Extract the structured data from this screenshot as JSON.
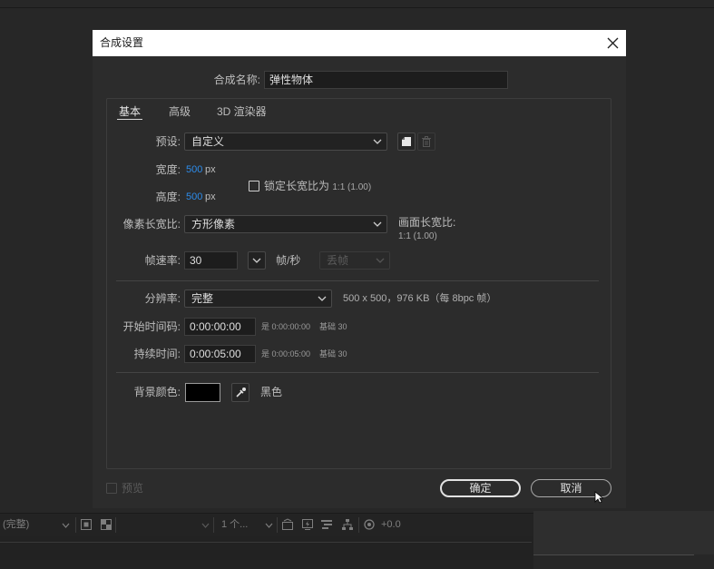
{
  "dialog": {
    "title": "合成设置",
    "close_icon": "close-icon",
    "name": {
      "label": "合成名称:",
      "value": "弹性物体"
    },
    "tabs": [
      {
        "label": "基本",
        "selected": true
      },
      {
        "label": "高级",
        "selected": false
      },
      {
        "label": "3D 渲染器",
        "selected": false
      }
    ],
    "preset": {
      "label": "预设:",
      "value": "自定义",
      "save_icon": "save-preset-icon",
      "delete_icon": "trash-icon"
    },
    "width": {
      "label": "宽度:",
      "value": "500",
      "unit": "px"
    },
    "height": {
      "label": "高度:",
      "value": "500",
      "unit": "px"
    },
    "lock_aspect": {
      "label": "锁定长宽比为",
      "ratio": "1:1 (1.00)",
      "checked": false
    },
    "pixel_aspect": {
      "label": "像素长宽比:",
      "value": "方形像素"
    },
    "frame_aspect": {
      "label": "画面长宽比:",
      "value": "1:1 (1.00)"
    },
    "frame_rate": {
      "label": "帧速率:",
      "value": "30",
      "unit": "帧/秒",
      "drop_frame": "丢帧",
      "drop_frame_enabled": false
    },
    "resolution": {
      "label": "分辨率:",
      "value": "完整",
      "info": "500 x 500，976 KB（每 8bpc 帧）"
    },
    "start_timecode": {
      "label": "开始时间码:",
      "value": "0:00:00:00",
      "is": "是 0:00:00:00",
      "base": "基础 30"
    },
    "duration": {
      "label": "持续时间:",
      "value": "0:00:05:00",
      "is": "是 0:00:05:00",
      "base": "基础 30"
    },
    "background": {
      "label": "背景颜色:",
      "color": "#000000",
      "color_name": "黑色",
      "eyedropper_icon": "eyedropper-icon"
    },
    "preview": {
      "label": "预览",
      "checked": false,
      "enabled": false
    },
    "buttons": {
      "ok": "确定",
      "cancel": "取消"
    }
  },
  "viewer_toolbar": {
    "resolution": "(完整)",
    "views": "1 个...",
    "exposure": "+0.0",
    "icons": [
      "region-of-interest-icon",
      "transparency-grid-icon",
      "pixel-aspect-icon",
      "fast-previews-icon",
      "timeline-icon",
      "flowchart-icon",
      "reset-exposure-icon"
    ]
  },
  "colors": {
    "accent_blue": "#2d8ceb",
    "titlebar": "#ffffff",
    "dialog_bg": "#2c2c2c"
  }
}
